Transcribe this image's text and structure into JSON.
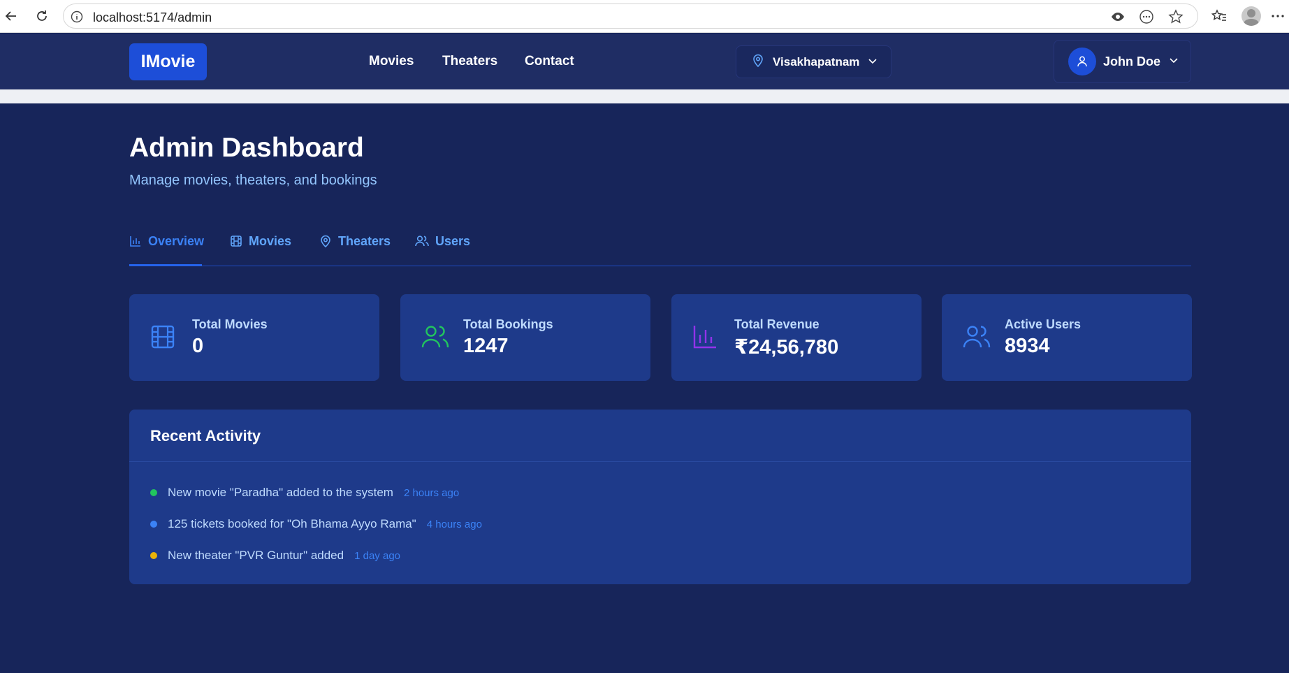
{
  "browser": {
    "url": "localhost:5174/admin"
  },
  "nav": {
    "logo": "IMovie",
    "links": [
      "Movies",
      "Theaters",
      "Contact"
    ],
    "city": "Visakhapatnam",
    "user_name": "John Doe"
  },
  "dashboard": {
    "title": "Admin Dashboard",
    "subtitle": "Manage movies, theaters, and bookings"
  },
  "tabs": [
    {
      "label": "Overview",
      "icon": "bar-chart-icon",
      "active": true
    },
    {
      "label": "Movies",
      "icon": "film-icon",
      "active": false
    },
    {
      "label": "Theaters",
      "icon": "map-pin-icon",
      "active": false
    },
    {
      "label": "Users",
      "icon": "users-icon",
      "active": false
    }
  ],
  "stats": [
    {
      "label": "Total Movies",
      "value": "0",
      "icon": "film-icon",
      "color": "#3b82f6"
    },
    {
      "label": "Total Bookings",
      "value": "1247",
      "icon": "users-icon",
      "color": "#22c55e"
    },
    {
      "label": "Total Revenue",
      "value": "₹24,56,780",
      "icon": "bar-chart-icon",
      "color": "#9333ea"
    },
    {
      "label": "Active Users",
      "value": "8934",
      "icon": "users-icon",
      "color": "#3b82f6"
    }
  ],
  "activity": {
    "title": "Recent Activity",
    "items": [
      {
        "text": "New movie \"Paradha\" added to the system",
        "time": "2 hours ago",
        "color": "#22c55e"
      },
      {
        "text": "125 tickets booked for \"Oh Bhama Ayyo Rama\"",
        "time": "4 hours ago",
        "color": "#3b82f6"
      },
      {
        "text": "New theater \"PVR Guntur\" added",
        "time": "1 day ago",
        "color": "#eab308"
      }
    ]
  }
}
